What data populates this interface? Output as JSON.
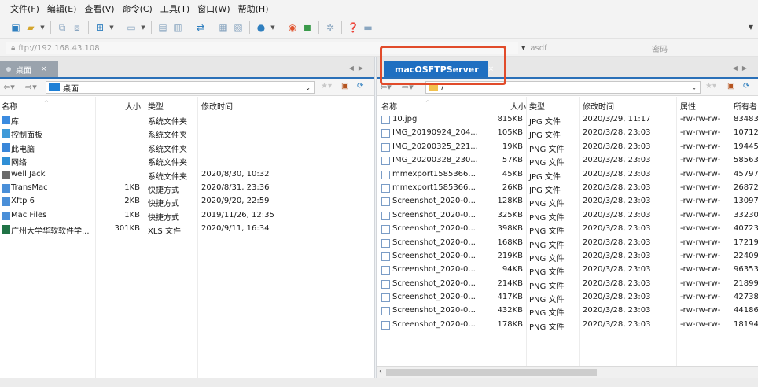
{
  "menu": [
    "文件(F)",
    "编辑(E)",
    "查看(V)",
    "命令(C)",
    "工具(T)",
    "窗口(W)",
    "帮助(H)"
  ],
  "address": {
    "host": "ftp://192.168.43.108",
    "user": "asdf",
    "password_placeholder": "密码"
  },
  "left": {
    "tab": "桌面",
    "tab_close": "×",
    "path": "桌面",
    "columns": {
      "name": "名称",
      "size": "大小",
      "type": "类型",
      "modified": "修改时间"
    },
    "rows": [
      {
        "name": "库",
        "size": "",
        "type": "系统文件夹",
        "modified": "",
        "icon": "library-icon"
      },
      {
        "name": "控制面板",
        "size": "",
        "type": "系统文件夹",
        "modified": "",
        "icon": "control-panel-icon"
      },
      {
        "name": "此电脑",
        "size": "",
        "type": "系统文件夹",
        "modified": "",
        "icon": "computer-icon"
      },
      {
        "name": "网络",
        "size": "",
        "type": "系统文件夹",
        "modified": "",
        "icon": "network-icon"
      },
      {
        "name": "well Jack",
        "size": "",
        "type": "系统文件夹",
        "modified": "2020/8/30, 10:32",
        "icon": "user-folder-icon"
      },
      {
        "name": "TransMac",
        "size": "1KB",
        "type": "快捷方式",
        "modified": "2020/8/31, 23:36",
        "icon": "shortcut-icon"
      },
      {
        "name": "Xftp 6",
        "size": "2KB",
        "type": "快捷方式",
        "modified": "2020/9/20, 22:59",
        "icon": "shortcut-icon"
      },
      {
        "name": "Mac Files",
        "size": "1KB",
        "type": "快捷方式",
        "modified": "2019/11/26, 12:35",
        "icon": "shortcut-icon"
      },
      {
        "name": "广州大学华软软件学...",
        "size": "301KB",
        "type": "XLS 文件",
        "modified": "2020/9/11, 16:34",
        "icon": "excel-file-icon"
      }
    ]
  },
  "right": {
    "tab": "macOSFTPServer",
    "tab_close": "×",
    "path": "/",
    "columns": {
      "name": "名称",
      "size": "大小",
      "type": "类型",
      "modified": "修改时间",
      "perm": "属性",
      "owner": "所有者"
    },
    "rows": [
      {
        "name": "10.jpg",
        "size": "815KB",
        "type": "JPG 文件",
        "modified": "2020/3/29, 11:17",
        "perm": "-rw-rw-rw-",
        "owner": "83483"
      },
      {
        "name": "IMG_20190924_204...",
        "size": "105KB",
        "type": "JPG 文件",
        "modified": "2020/3/28, 23:03",
        "perm": "-rw-rw-rw-",
        "owner": "10712"
      },
      {
        "name": "IMG_20200325_221...",
        "size": "19KB",
        "type": "PNG 文件",
        "modified": "2020/3/28, 23:03",
        "perm": "-rw-rw-rw-",
        "owner": "19445"
      },
      {
        "name": "IMG_20200328_230...",
        "size": "57KB",
        "type": "PNG 文件",
        "modified": "2020/3/28, 23:03",
        "perm": "-rw-rw-rw-",
        "owner": "58563"
      },
      {
        "name": "mmexport1585366...",
        "size": "45KB",
        "type": "JPG 文件",
        "modified": "2020/3/28, 23:03",
        "perm": "-rw-rw-rw-",
        "owner": "45797"
      },
      {
        "name": "mmexport1585366...",
        "size": "26KB",
        "type": "JPG 文件",
        "modified": "2020/3/28, 23:03",
        "perm": "-rw-rw-rw-",
        "owner": "26872"
      },
      {
        "name": "Screenshot_2020-0...",
        "size": "128KB",
        "type": "PNG 文件",
        "modified": "2020/3/28, 23:03",
        "perm": "-rw-rw-rw-",
        "owner": "13097"
      },
      {
        "name": "Screenshot_2020-0...",
        "size": "325KB",
        "type": "PNG 文件",
        "modified": "2020/3/28, 23:03",
        "perm": "-rw-rw-rw-",
        "owner": "33230"
      },
      {
        "name": "Screenshot_2020-0...",
        "size": "398KB",
        "type": "PNG 文件",
        "modified": "2020/3/28, 23:03",
        "perm": "-rw-rw-rw-",
        "owner": "40723"
      },
      {
        "name": "Screenshot_2020-0...",
        "size": "168KB",
        "type": "PNG 文件",
        "modified": "2020/3/28, 23:03",
        "perm": "-rw-rw-rw-",
        "owner": "17219"
      },
      {
        "name": "Screenshot_2020-0...",
        "size": "219KB",
        "type": "PNG 文件",
        "modified": "2020/3/28, 23:03",
        "perm": "-rw-rw-rw-",
        "owner": "22409"
      },
      {
        "name": "Screenshot_2020-0...",
        "size": "94KB",
        "type": "PNG 文件",
        "modified": "2020/3/28, 23:03",
        "perm": "-rw-rw-rw-",
        "owner": "96353"
      },
      {
        "name": "Screenshot_2020-0...",
        "size": "214KB",
        "type": "PNG 文件",
        "modified": "2020/3/28, 23:03",
        "perm": "-rw-rw-rw-",
        "owner": "21899"
      },
      {
        "name": "Screenshot_2020-0...",
        "size": "417KB",
        "type": "PNG 文件",
        "modified": "2020/3/28, 23:03",
        "perm": "-rw-rw-rw-",
        "owner": "42738"
      },
      {
        "name": "Screenshot_2020-0...",
        "size": "432KB",
        "type": "PNG 文件",
        "modified": "2020/3/28, 23:03",
        "perm": "-rw-rw-rw-",
        "owner": "44186"
      },
      {
        "name": "Screenshot_2020-0...",
        "size": "178KB",
        "type": "PNG 文件",
        "modified": "2020/3/28, 23:03",
        "perm": "-rw-rw-rw-",
        "owner": "18194"
      }
    ]
  },
  "colors": {
    "accent": "#1f6fc1",
    "highlight": "#e14b2a",
    "folder": "#f2c14e"
  }
}
